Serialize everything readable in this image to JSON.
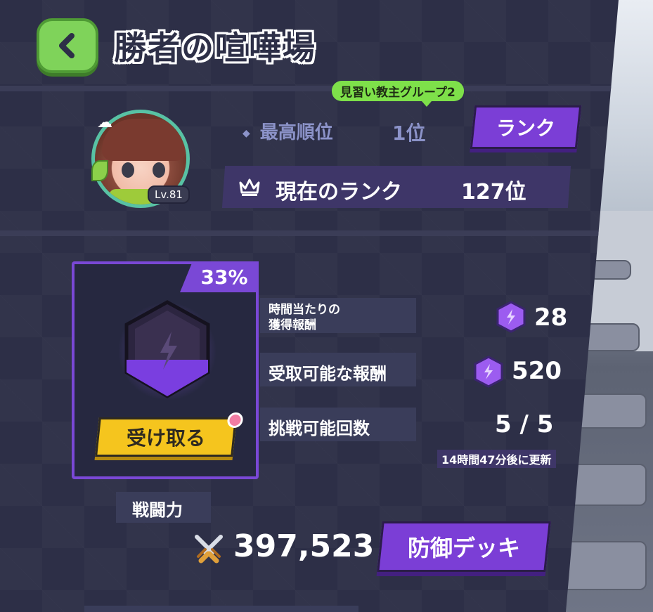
{
  "header": {
    "title": "勝者の喧嘩場"
  },
  "profile": {
    "level": "Lv.81"
  },
  "group": {
    "name": "見習い教主グループ2"
  },
  "best_rank": {
    "label": "最高順位",
    "value": "1位"
  },
  "rank_button": {
    "label": "ランク"
  },
  "current_rank": {
    "label": "現在のランク",
    "value": "127位"
  },
  "reward": {
    "percent": "33%",
    "claim_label": "受け取る"
  },
  "stats": {
    "hourly_label_line1": "時間当たりの",
    "hourly_label_line2": "獲得報酬",
    "hourly_value": "28",
    "claimable_label": "受取可能な報酬",
    "claimable_value": "520",
    "attempts_label": "挑戦可能回数",
    "attempts_value": "5 / 5",
    "refresh_note": "14時間47分後に更新"
  },
  "power": {
    "label": "戦闘力",
    "value": "397,523"
  },
  "deck_button": {
    "label": "防御デッキ"
  },
  "colors": {
    "panel": "#2d2f47",
    "accent_purple": "#7b3ed6",
    "accent_green": "#7ee04a",
    "accent_yellow": "#f5c51e",
    "muted_text": "#8c93c9"
  },
  "icons": [
    "chevron-left-icon",
    "crown-icon",
    "diamond-bullet-icon",
    "purple-gem-icon",
    "crossed-swords-icon",
    "flower-icon",
    "cloud-icon",
    "leaf-icon"
  ]
}
